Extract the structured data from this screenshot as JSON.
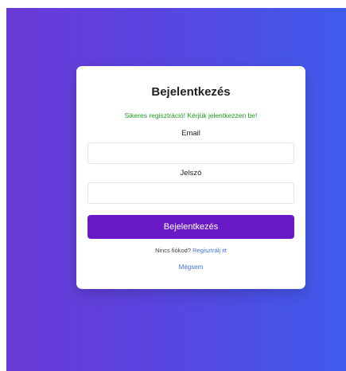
{
  "login": {
    "title": "Bejelentkezés",
    "success_message": "Sikeres regisztráció! Kérjük jelentkezzen be!",
    "email_label": "Email",
    "email_value": "",
    "password_label": "Jelszó",
    "password_value": "",
    "submit_label": "Bejelentkezés",
    "no_account_text": "Nincs fiókod?",
    "register_link": "Regisztrálj itt",
    "cancel_link": "Mégsem"
  },
  "colors": {
    "background_gradient_start": "#6a3ad8",
    "background_gradient_end": "#3f5bec",
    "primary_button": "#6a19c6",
    "success_text": "#1e9a1e",
    "link": "#3f70e0"
  }
}
